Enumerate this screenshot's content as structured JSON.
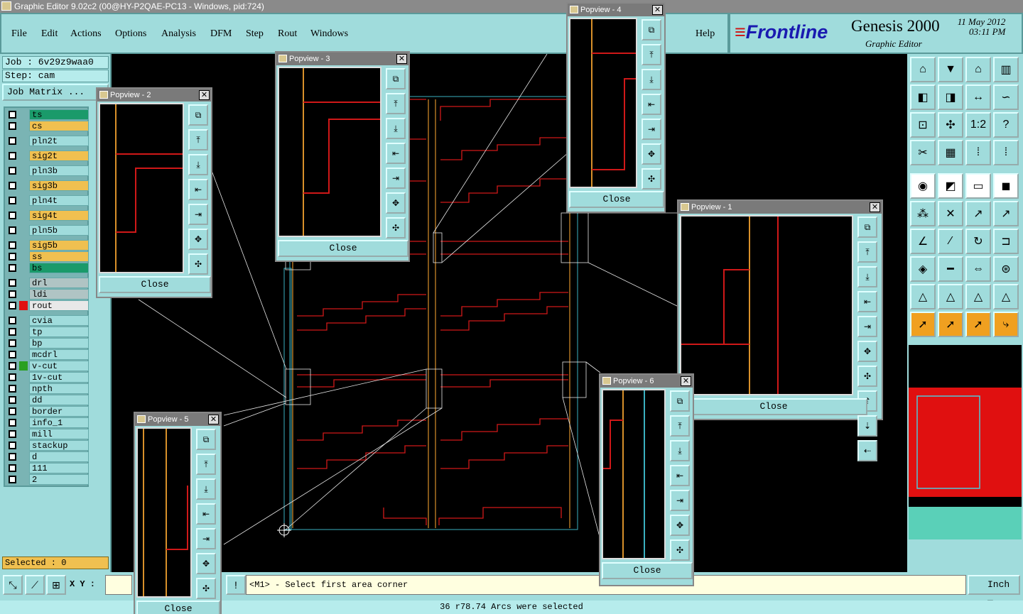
{
  "window": {
    "title": "Graphic Editor 9.02c2 (00@HY-P2QAE-PC13 - Windows, pid:724)"
  },
  "menu": [
    "File",
    "Edit",
    "Actions",
    "Options",
    "Analysis",
    "DFM",
    "Step",
    "Rout",
    "Windows"
  ],
  "help_label": "Help",
  "brand": {
    "logo": "Frontline",
    "product": "Genesis 2000",
    "date": "11 May 2012",
    "time": "03:11 PM",
    "subtitle": "Graphic Editor"
  },
  "job": {
    "job_line": "Job : 6v29z9waa0",
    "step_line": "Step: cam",
    "matrix_label": "Job Matrix ..."
  },
  "layers": [
    {
      "name": "ts",
      "color": "#1a9a6a"
    },
    {
      "name": "cs",
      "color": "#f0c050"
    },
    {
      "name": "pln2t",
      "color": "#a0dcdc"
    },
    {
      "name": "sig2t",
      "color": "#f0c050"
    },
    {
      "name": "pln3b",
      "color": "#a0dcdc"
    },
    {
      "name": "sig3b",
      "color": "#f0c050"
    },
    {
      "name": "pln4t",
      "color": "#a0dcdc"
    },
    {
      "name": "sig4t",
      "color": "#f0c050"
    },
    {
      "name": "pln5b",
      "color": "#a0dcdc"
    },
    {
      "name": "sig5b",
      "color": "#f0c050"
    },
    {
      "name": "ss",
      "color": "#f0c050"
    },
    {
      "name": "bs",
      "color": "#1a9a6a"
    },
    {
      "name": "drl",
      "color": "#b0c4c4"
    },
    {
      "name": "ldi",
      "color": "#b0c4c4"
    },
    {
      "name": "rout",
      "color": "#e8e8e8"
    },
    {
      "name": "cvia",
      "color": "#a0dcdc"
    },
    {
      "name": "tp",
      "color": "#a0dcdc"
    },
    {
      "name": "bp",
      "color": "#a0dcdc"
    },
    {
      "name": "mcdrl",
      "color": "#a0dcdc"
    },
    {
      "name": "v-cut",
      "color": "#a0dcdc"
    },
    {
      "name": "1v-cut",
      "color": "#a0dcdc"
    },
    {
      "name": "npth",
      "color": "#a0dcdc"
    },
    {
      "name": "dd",
      "color": "#a0dcdc"
    },
    {
      "name": "border",
      "color": "#a0dcdc"
    },
    {
      "name": "info_1",
      "color": "#a0dcdc"
    },
    {
      "name": "mill",
      "color": "#a0dcdc"
    },
    {
      "name": "stackup",
      "color": "#a0dcdc"
    },
    {
      "name": "d",
      "color": "#a0dcdc"
    },
    {
      "name": "111",
      "color": "#a0dcdc"
    },
    {
      "name": "2",
      "color": "#a0dcdc"
    }
  ],
  "selected_label": "Selected : 0",
  "popviews": [
    {
      "title": "Popview - 1",
      "close": "Close"
    },
    {
      "title": "Popview - 2",
      "close": "Close"
    },
    {
      "title": "Popview - 3",
      "close": "Close"
    },
    {
      "title": "Popview - 4",
      "close": "Close"
    },
    {
      "title": "Popview - 5",
      "close": "Close"
    },
    {
      "title": "Popview - 6",
      "close": "Close"
    }
  ],
  "bottom": {
    "xy_label": "X Y :",
    "prompt": "<M1> - Select first area corner",
    "units": "Inch",
    "status": "36 r78.74 Arcs were selected"
  },
  "tools": {
    "ratio": "1:2",
    "help": "?"
  }
}
